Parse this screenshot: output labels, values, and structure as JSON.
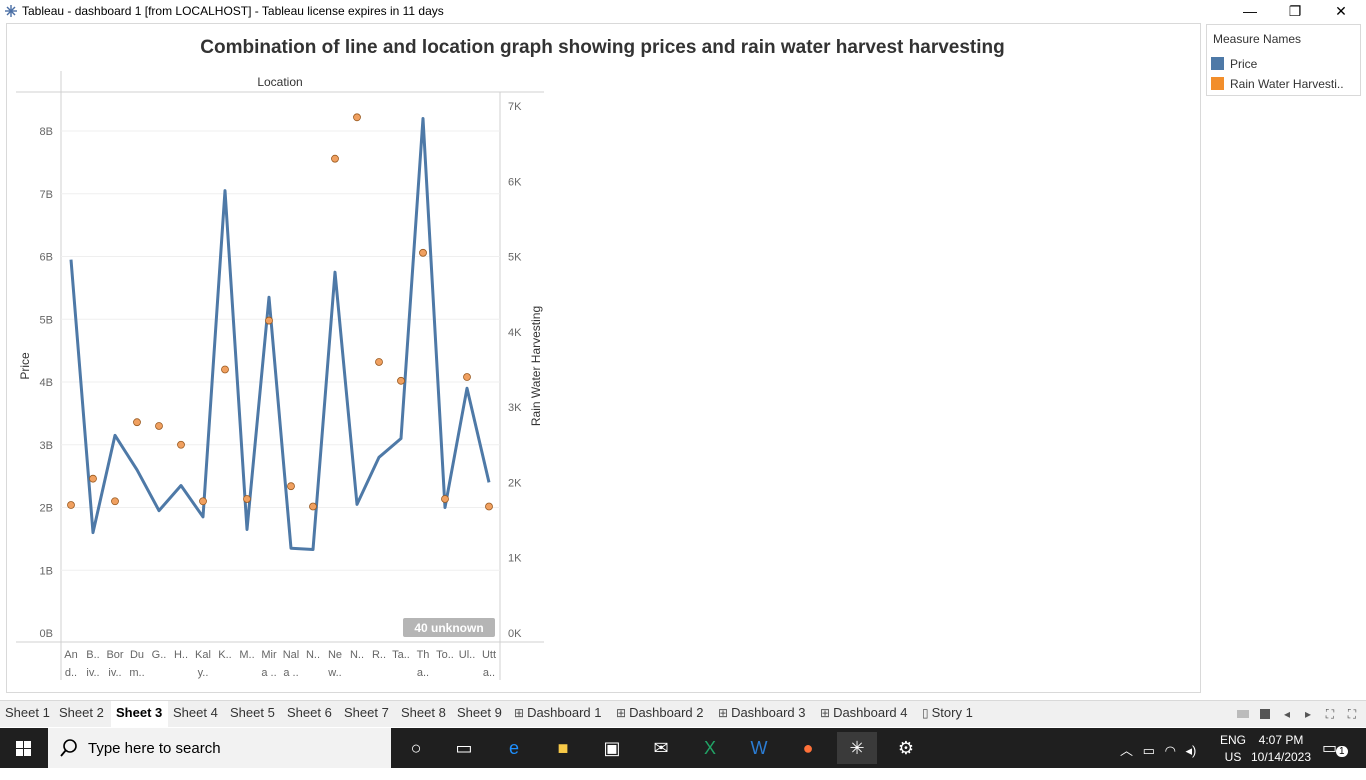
{
  "window": {
    "title": "Tableau - dashboard 1 [from LOCALHOST] - Tableau license expires in 11 days",
    "minimize": "—",
    "restore": "❐",
    "close": "✕"
  },
  "chart_title": "Combination of line and location graph showing prices and rain water harvest harvesting",
  "legend": {
    "title": "Measure Names",
    "items": [
      {
        "label": "Price",
        "color": "#4e79a7"
      },
      {
        "label": "Rain Water Harvesti..",
        "color": "#f28e2b"
      }
    ]
  },
  "chart_data": {
    "type": "line",
    "column_header": "Location",
    "ylabel_left": "Price",
    "ylabel_right": "Rain Water Harvesting",
    "left_ticks": [
      "0B",
      "1B",
      "2B",
      "3B",
      "4B",
      "5B",
      "6B",
      "7B",
      "8B"
    ],
    "right_ticks": [
      "0K",
      "1K",
      "2K",
      "3K",
      "4K",
      "5K",
      "6K",
      "7K"
    ],
    "ylim_left": [
      0,
      8.8
    ],
    "ylim_right": [
      0,
      7.2
    ],
    "categories": [
      [
        "An",
        "d.."
      ],
      [
        "B..",
        "iv.."
      ],
      [
        "Bor",
        "iv.."
      ],
      [
        "Du",
        "m.."
      ],
      [
        "G.."
      ],
      [
        "H.."
      ],
      [
        "Kal",
        "y.."
      ],
      [
        "K.."
      ],
      [
        "M.."
      ],
      [
        "Mir",
        "a .."
      ],
      [
        "Nal",
        "a .."
      ],
      [
        "N.."
      ],
      [
        "Ne",
        "w.."
      ],
      [
        "N.."
      ],
      [
        "R.."
      ],
      [
        "Ta.."
      ],
      [
        "Th",
        "a.."
      ],
      [
        "To.."
      ],
      [
        "Ul.."
      ],
      [
        "Utt",
        "a.."
      ]
    ],
    "series": [
      {
        "name": "Price",
        "axis": "left",
        "color": "#4e79a7",
        "mark": "line",
        "values": [
          5.95,
          1.6,
          3.15,
          2.6,
          1.95,
          2.35,
          1.85,
          7.05,
          1.65,
          5.35,
          1.35,
          1.33,
          5.75,
          2.05,
          2.8,
          3.1,
          8.2,
          2.0,
          3.9,
          2.4
        ]
      },
      {
        "name": "Rain Water Harvesting",
        "axis": "right",
        "color": "#f28e2b",
        "mark": "circle",
        "values": [
          1.7,
          2.05,
          1.75,
          2.8,
          2.75,
          2.5,
          1.75,
          3.5,
          1.78,
          4.15,
          1.95,
          1.68,
          6.3,
          6.85,
          3.6,
          3.35,
          5.05,
          1.78,
          3.4,
          1.68
        ]
      }
    ],
    "annotation": "40 unknown",
    "grid": true
  },
  "tabs": [
    {
      "label": "Sheet 1",
      "icon": ""
    },
    {
      "label": "Sheet 2",
      "icon": ""
    },
    {
      "label": "Sheet 3",
      "icon": "",
      "active": true
    },
    {
      "label": "Sheet 4",
      "icon": ""
    },
    {
      "label": "Sheet 5",
      "icon": ""
    },
    {
      "label": "Sheet 6",
      "icon": ""
    },
    {
      "label": "Sheet 7",
      "icon": ""
    },
    {
      "label": "Sheet 8",
      "icon": ""
    },
    {
      "label": "Sheet 9",
      "icon": ""
    },
    {
      "label": "Dashboard 1",
      "icon": "dashboard-icon"
    },
    {
      "label": "Dashboard 2",
      "icon": "dashboard-icon"
    },
    {
      "label": "Dashboard 3",
      "icon": "dashboard-icon"
    },
    {
      "label": "Dashboard 4",
      "icon": "dashboard-icon"
    },
    {
      "label": "Story 1",
      "icon": "story-icon"
    }
  ],
  "taskbar": {
    "search_placeholder": "Type here to search",
    "lang_top": "ENG",
    "lang_bottom": "US",
    "time": "4:07 PM",
    "date": "10/14/2023",
    "notification_count": "1"
  }
}
